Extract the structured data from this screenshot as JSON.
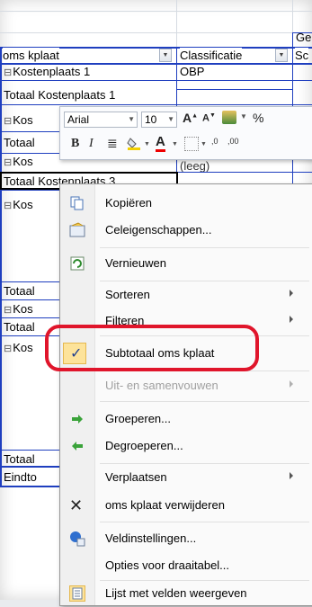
{
  "sheet": {
    "header_right_top": "Ge",
    "col_headers": {
      "oms_kplaat": "oms kplaat",
      "classificatie": "Classificatie",
      "right_partial": "Sc"
    },
    "rows": {
      "r_kostenplaats1": "Kostenplaats 1",
      "r_obp": "OBP",
      "r_totaal_kp1": "Totaal Kostenplaats 1",
      "r_kos": "Kos",
      "r_totaal": "Totaal",
      "r_totaal_kp3": "Totaal Kostenplaats 3",
      "r_leeg": "(leeg)",
      "r_kos_b": "Kos",
      "r_totaal_b": "Totaal",
      "r_kos_c": "Kos",
      "r_totaal_c": "Totaal",
      "r_kos_d": "Kos",
      "r_totaal_d": "Totaal",
      "r_eindto": "Eindto"
    }
  },
  "mini_toolbar": {
    "font_name": "Arial",
    "font_size": "10",
    "grow_font": "A",
    "shrink_font": "A",
    "percent": "%",
    "bold": "B",
    "italic": "I",
    "font_color_letter": "A",
    "increase_decimal": ",0",
    "decrease_decimal": ",00"
  },
  "context_menu": {
    "items": [
      {
        "label": "Kopiëren",
        "icon": "copy-icon"
      },
      {
        "label": "Celeigenschappen...",
        "icon": "format-cells-icon"
      },
      {
        "label": "Vernieuwen",
        "icon": "refresh-icon"
      },
      {
        "label": "Sorteren",
        "submenu": true
      },
      {
        "label": "Filteren",
        "submenu": true
      },
      {
        "label": "Subtotaal oms kplaat",
        "checked": true
      },
      {
        "label": "Uit- en samenvouwen",
        "submenu": true,
        "disabled": true
      },
      {
        "label": "Groeperen...",
        "icon": "group-arrow-icon"
      },
      {
        "label": "Degroeperen...",
        "icon": "ungroup-arrow-icon"
      },
      {
        "label": "Verplaatsen",
        "submenu": true
      },
      {
        "label": "oms kplaat verwijderen",
        "icon": "delete-x-icon"
      },
      {
        "label": "Veldinstellingen...",
        "icon": "field-settings-icon"
      },
      {
        "label": "Opties voor draaitabel..."
      },
      {
        "label": "Lijst met velden weergeven",
        "icon": "field-list-icon"
      }
    ],
    "check_mark": "✓"
  },
  "colors": {
    "highlight_red": "#e0152b",
    "pivot_blue": "#1f3fbf",
    "check_bg": "#fde39a"
  }
}
